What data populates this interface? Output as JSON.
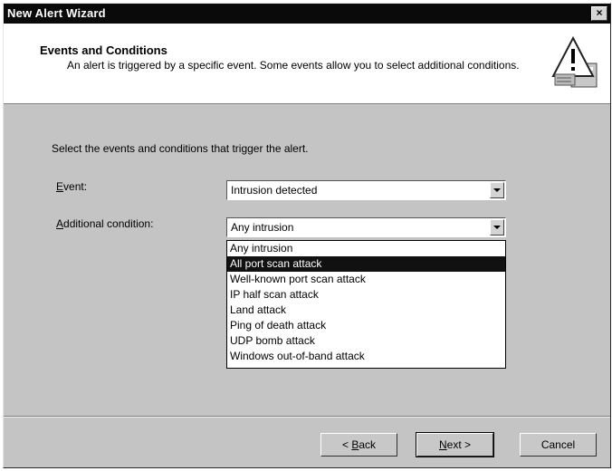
{
  "window": {
    "title": "New Alert Wizard",
    "close_glyph": "×"
  },
  "header": {
    "title": "Events and Conditions",
    "description": "An alert is triggered by a specific event. Some events allow you to select additional conditions.",
    "icon": "warning-icon"
  },
  "main": {
    "instruction": "Select the events and conditions that trigger the alert.",
    "event": {
      "label_access": "E",
      "label_rest": "vent:",
      "value": "Intrusion detected"
    },
    "condition": {
      "label_access": "A",
      "label_rest": "dditional condition:",
      "value": "Any intrusion",
      "options": [
        "Any intrusion",
        "All port scan attack",
        "Well-known port scan attack",
        "IP half scan attack",
        "Land attack",
        "Ping of death attack",
        "UDP bomb attack",
        "Windows out-of-band attack"
      ],
      "highlighted_index": 1
    }
  },
  "footer": {
    "back": {
      "pre": "< ",
      "access": "B",
      "rest": "ack"
    },
    "next": {
      "access": "N",
      "rest": "ext >"
    },
    "cancel": "Cancel"
  }
}
